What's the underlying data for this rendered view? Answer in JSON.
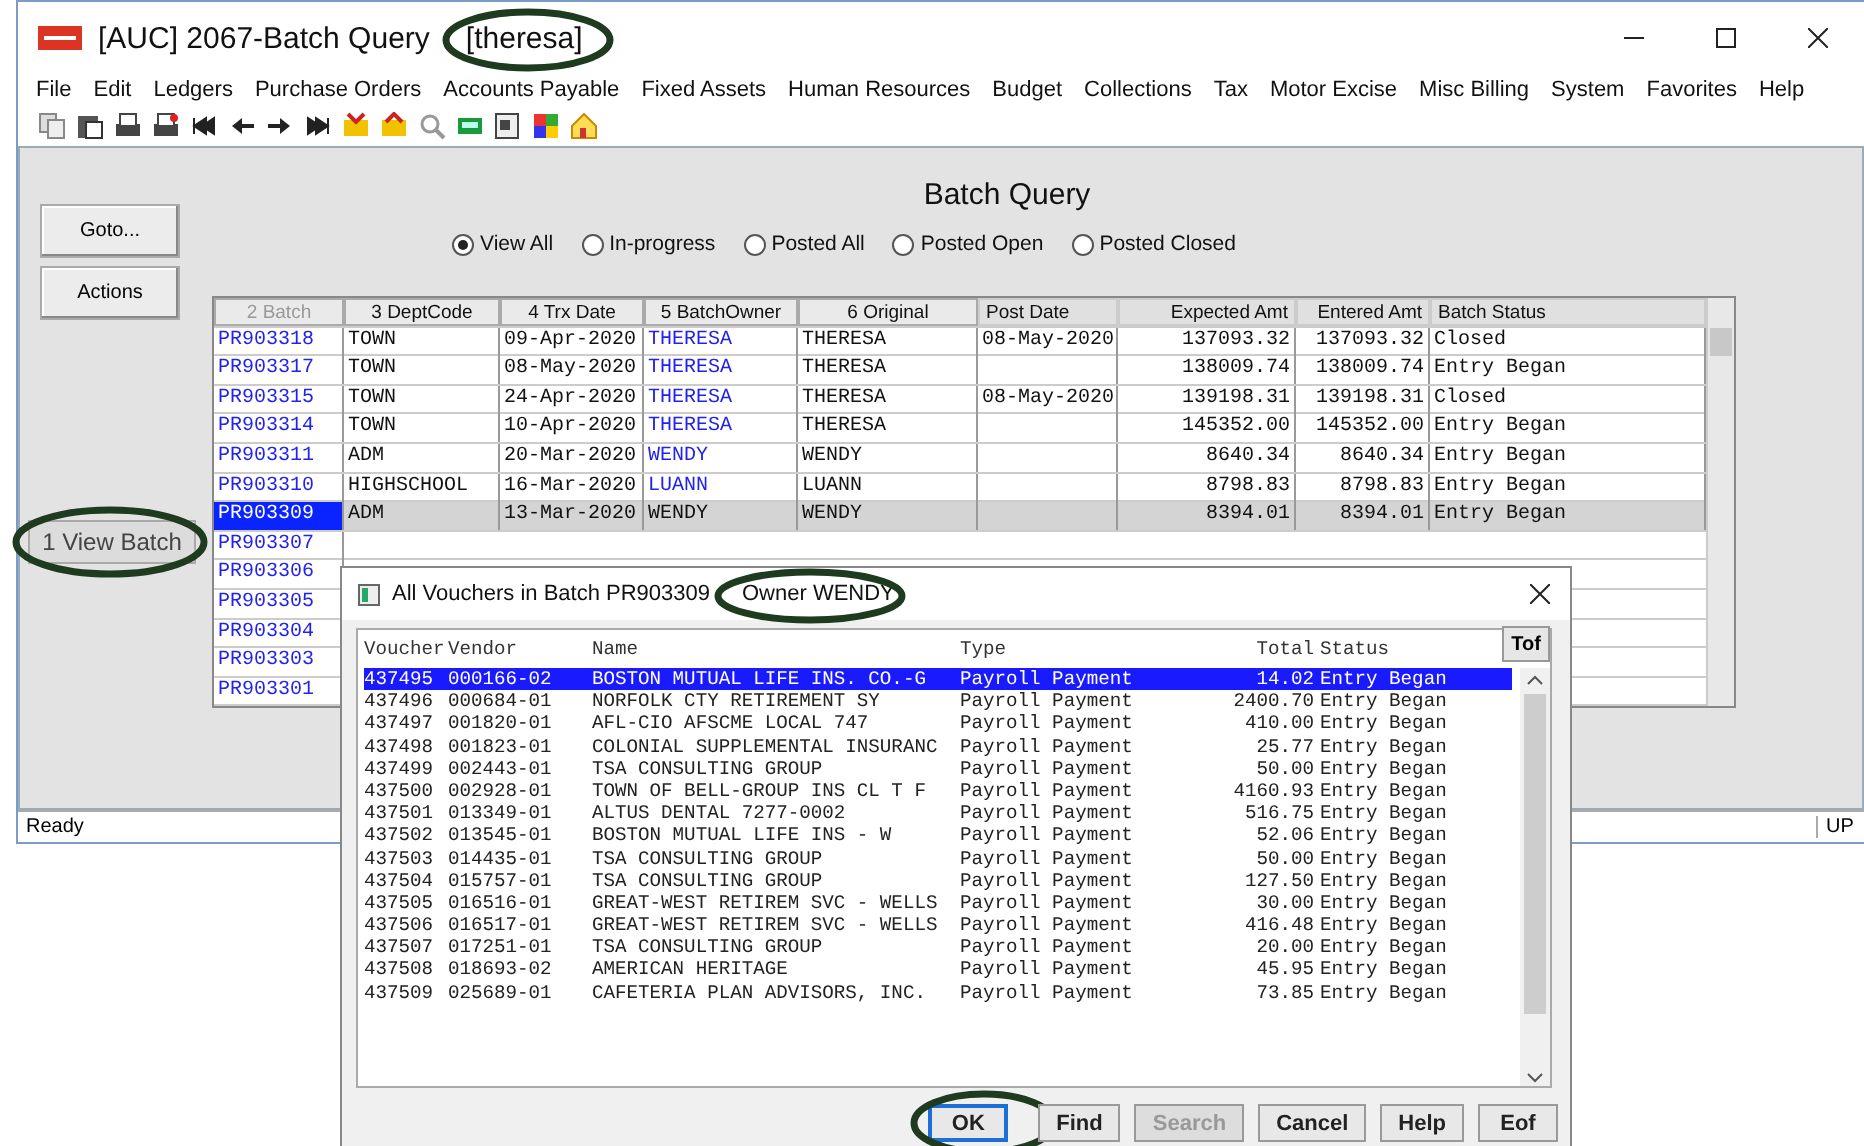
{
  "window": {
    "title": "[AUC] 2067-Batch Query",
    "user": "[theresa]",
    "menu": [
      "File",
      "Edit",
      "Ledgers",
      "Purchase Orders",
      "Accounts Payable",
      "Fixed Assets",
      "Human Resources",
      "Budget",
      "Collections",
      "Tax",
      "Motor Excise",
      "Misc Billing",
      "System",
      "Favorites",
      "Help"
    ]
  },
  "side_buttons": [
    "Goto...",
    "Actions"
  ],
  "heading": "Batch Query",
  "filters": [
    {
      "label": "View All",
      "selected": true
    },
    {
      "label": "In-progress",
      "selected": false
    },
    {
      "label": "Posted All",
      "selected": false
    },
    {
      "label": "Posted Open",
      "selected": false
    },
    {
      "label": "Posted Closed",
      "selected": false
    }
  ],
  "table": {
    "columns": [
      {
        "label": "2 Batch",
        "kind": "button",
        "sorted": true
      },
      {
        "label": "3 DeptCode",
        "kind": "button",
        "sorted": false
      },
      {
        "label": "4 Trx Date",
        "kind": "button",
        "sorted": false
      },
      {
        "label": "5 BatchOwner",
        "kind": "button",
        "sorted": false
      },
      {
        "label": "6 Original",
        "kind": "button",
        "sorted": false
      },
      {
        "label": "Post Date",
        "kind": "plain",
        "sorted": false
      },
      {
        "label": "Expected Amt",
        "kind": "plain",
        "sorted": false
      },
      {
        "label": "Entered Amt",
        "kind": "plain",
        "sorted": false
      },
      {
        "label": "Batch Status",
        "kind": "plain",
        "sorted": false
      }
    ],
    "rows": [
      {
        "selected": false,
        "cells": [
          "PR903318",
          "TOWN",
          "09-Apr-2020",
          "THERESA",
          "THERESA",
          "08-May-2020",
          "137093.32",
          "137093.32",
          "Closed"
        ]
      },
      {
        "selected": false,
        "cells": [
          "PR903317",
          "TOWN",
          "08-May-2020",
          "THERESA",
          "THERESA",
          "",
          "138009.74",
          "138009.74",
          "Entry Began"
        ]
      },
      {
        "selected": false,
        "cells": [
          "PR903315",
          "TOWN",
          "24-Apr-2020",
          "THERESA",
          "THERESA",
          "08-May-2020",
          "139198.31",
          "139198.31",
          "Closed"
        ]
      },
      {
        "selected": false,
        "cells": [
          "PR903314",
          "TOWN",
          "10-Apr-2020",
          "THERESA",
          "THERESA",
          "",
          "145352.00",
          "145352.00",
          "Entry Began"
        ]
      },
      {
        "selected": false,
        "cells": [
          "PR903311",
          "ADM",
          "20-Mar-2020",
          "WENDY",
          "WENDY",
          "",
          "8640.34",
          "8640.34",
          "Entry Began"
        ]
      },
      {
        "selected": false,
        "cells": [
          "PR903310",
          "HIGHSCHOOL",
          "16-Mar-2020",
          "LUANN",
          "LUANN",
          "",
          "8798.83",
          "8798.83",
          "Entry Began"
        ]
      },
      {
        "selected": true,
        "cells": [
          "PR903309",
          "ADM",
          "13-Mar-2020",
          "WENDY",
          "WENDY",
          "",
          "8394.01",
          "8394.01",
          "Entry Began"
        ]
      },
      {
        "selected": false,
        "cells": [
          "PR903307"
        ]
      },
      {
        "selected": false,
        "cells": [
          "PR903306"
        ]
      },
      {
        "selected": false,
        "cells": [
          "PR903305"
        ]
      },
      {
        "selected": false,
        "cells": [
          "PR903304"
        ]
      },
      {
        "selected": false,
        "cells": [
          "PR903303"
        ]
      },
      {
        "selected": false,
        "cells": [
          "PR903301"
        ]
      }
    ]
  },
  "float_button": "1 View Batch",
  "status_bar": {
    "text": "Ready",
    "mode": "UP"
  },
  "dialog": {
    "title": "All Vouchers in Batch PR903309",
    "owner": "Owner WENDY",
    "columns": [
      "Voucher",
      "Vendor",
      "Name",
      "Type",
      "Total",
      "Status"
    ],
    "top_button": "Tof",
    "rows": [
      {
        "selected": true,
        "cells": [
          "437495",
          "000166-02",
          "BOSTON MUTUAL LIFE INS. CO.-G",
          "Payroll Payment",
          "14.02",
          "Entry Began"
        ]
      },
      {
        "selected": false,
        "cells": [
          "437496",
          "000684-01",
          "NORFOLK CTY RETIREMENT SY",
          "Payroll Payment",
          "2400.70",
          "Entry Began"
        ]
      },
      {
        "selected": false,
        "cells": [
          "437497",
          "001820-01",
          "AFL-CIO AFSCME LOCAL 747",
          "Payroll Payment",
          "410.00",
          "Entry Began"
        ]
      },
      {
        "selected": false,
        "cells": [
          "437498",
          "001823-01",
          "COLONIAL SUPPLEMENTAL INSURANC",
          "Payroll Payment",
          "25.77",
          "Entry Began"
        ]
      },
      {
        "selected": false,
        "cells": [
          "437499",
          "002443-01",
          "TSA CONSULTING GROUP",
          "Payroll Payment",
          "50.00",
          "Entry Began"
        ]
      },
      {
        "selected": false,
        "cells": [
          "437500",
          "002928-01",
          "TOWN OF BELL-GROUP INS CL T F",
          "Payroll Payment",
          "4160.93",
          "Entry Began"
        ]
      },
      {
        "selected": false,
        "cells": [
          "437501",
          "013349-01",
          "ALTUS DENTAL 7277-0002",
          "Payroll Payment",
          "516.75",
          "Entry Began"
        ]
      },
      {
        "selected": false,
        "cells": [
          "437502",
          "013545-01",
          "BOSTON MUTUAL LIFE INS - W",
          "Payroll Payment",
          "52.06",
          "Entry Began"
        ]
      },
      {
        "selected": false,
        "cells": [
          "437503",
          "014435-01",
          "TSA CONSULTING GROUP",
          "Payroll Payment",
          "50.00",
          "Entry Began"
        ]
      },
      {
        "selected": false,
        "cells": [
          "437504",
          "015757-01",
          "TSA CONSULTING GROUP",
          "Payroll Payment",
          "127.50",
          "Entry Began"
        ]
      },
      {
        "selected": false,
        "cells": [
          "437505",
          "016516-01",
          "GREAT-WEST RETIREM SVC - WELLS",
          "Payroll Payment",
          "30.00",
          "Entry Began"
        ]
      },
      {
        "selected": false,
        "cells": [
          "437506",
          "016517-01",
          "GREAT-WEST RETIREM SVC - WELLS",
          "Payroll Payment",
          "416.48",
          "Entry Began"
        ]
      },
      {
        "selected": false,
        "cells": [
          "437507",
          "017251-01",
          "TSA CONSULTING GROUP",
          "Payroll Payment",
          "20.00",
          "Entry Began"
        ]
      },
      {
        "selected": false,
        "cells": [
          "437508",
          "018693-02",
          "AMERICAN HERITAGE",
          "Payroll Payment",
          "45.95",
          "Entry Began"
        ]
      },
      {
        "selected": false,
        "cells": [
          "437509",
          "025689-01",
          "CAFETERIA PLAN ADVISORS, INC.",
          "Payroll Payment",
          "73.85",
          "Entry Began"
        ]
      }
    ],
    "buttons": [
      {
        "label": "OK",
        "disabled": false,
        "default": true
      },
      {
        "label": "Find",
        "disabled": false,
        "default": false
      },
      {
        "label": "Search",
        "disabled": true,
        "default": false
      },
      {
        "label": "Cancel",
        "disabled": false,
        "default": false
      },
      {
        "label": "Help",
        "disabled": false,
        "default": false
      },
      {
        "label": "Eof",
        "disabled": false,
        "default": false
      }
    ]
  }
}
